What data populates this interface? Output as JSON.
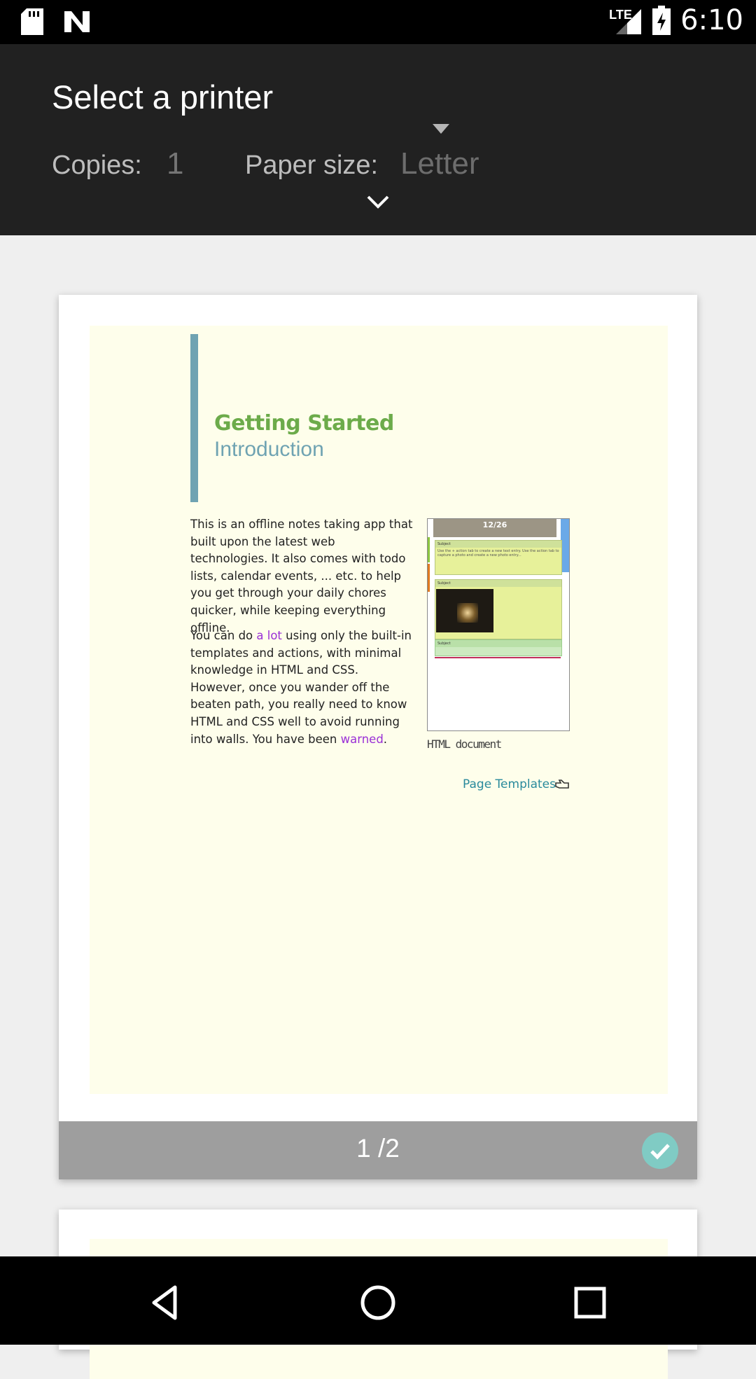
{
  "status_bar": {
    "time": "6:10",
    "network_label": "LTE",
    "icons": [
      "sd-card-icon",
      "n-logo-icon",
      "lte-signal-icon",
      "battery-charging-icon"
    ]
  },
  "print_options": {
    "printer_label": "Select a printer",
    "copies_label": "Copies:",
    "copies_value": "1",
    "paper_size_label": "Paper size:",
    "paper_size_value": "Letter"
  },
  "preview": {
    "title": "Getting Started",
    "subtitle": "Introduction",
    "paragraph1": "This is an offline notes taking app that built upon the latest web technologies. It also comes with todo lists, calendar events, ... etc. to help you get through your daily chores quicker, while keeping everything offline.",
    "paragraph2_before": "You can do ",
    "paragraph2_link1": "a lot",
    "paragraph2_middle": " using only the built-in templates and actions, with minimal knowledge in HTML and CSS. However, once you wander off the beaten path, you really need to know HTML and CSS well to avoid running into walls. You have been ",
    "paragraph2_link2": "warned",
    "paragraph2_after": ".",
    "thumbnail_date": "12/26",
    "thumbnail_subject1": "Subject",
    "thumbnail_subject2": "Subject",
    "thumbnail_subject3": "Subject",
    "thumbnail_caption": "HTML document",
    "next_link": "Page Templates",
    "page_indicator": "1 /2",
    "colors": {
      "page_bg": "#fefeeb",
      "title_green": "#6cab4a",
      "accent_blue": "#6fa3b2",
      "link_purple": "#9a2fd6"
    }
  }
}
